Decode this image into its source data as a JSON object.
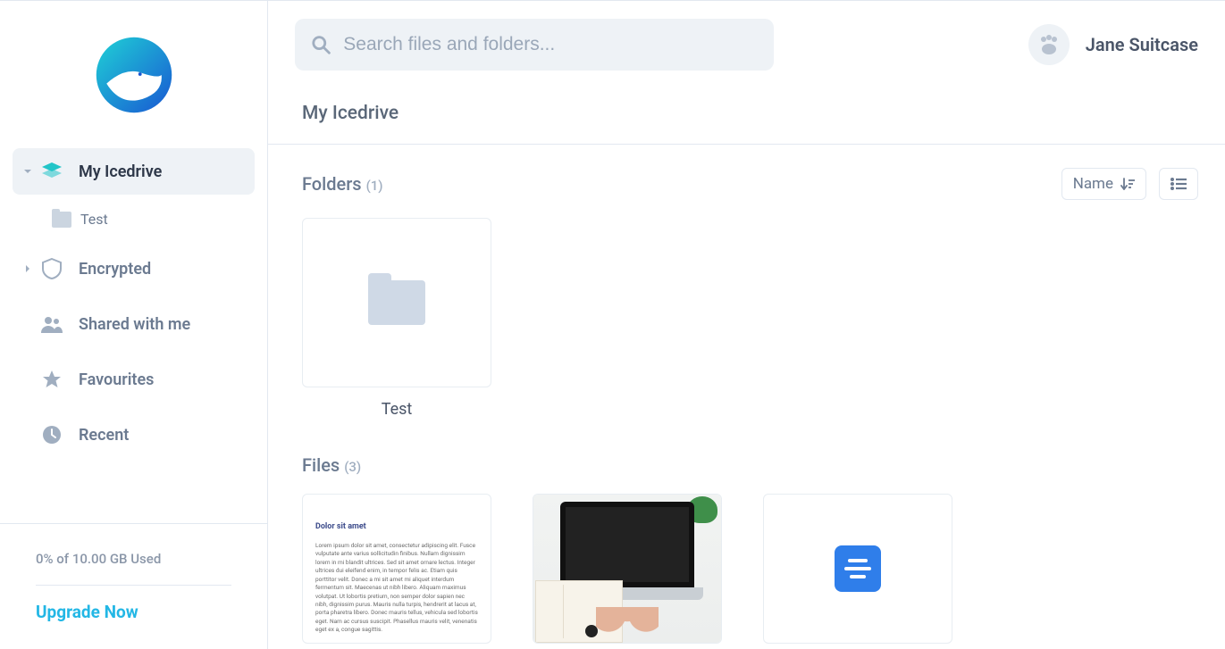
{
  "header": {
    "search_placeholder": "Search files and folders...",
    "user_name": "Jane Suitcase"
  },
  "breadcrumb": "My Icedrive",
  "sidebar": {
    "items": [
      {
        "label": "My Icedrive",
        "children": [
          {
            "label": "Test"
          }
        ]
      },
      {
        "label": "Encrypted"
      },
      {
        "label": "Shared with me"
      },
      {
        "label": "Favourites"
      },
      {
        "label": "Recent"
      }
    ],
    "storage_text": "0% of 10.00 GB Used",
    "upgrade_label": "Upgrade Now"
  },
  "sections": {
    "folders": {
      "title": "Folders",
      "count": "(1)",
      "items": [
        {
          "name": "Test"
        }
      ]
    },
    "files": {
      "title": "Files",
      "count": "(3)",
      "items": [
        {
          "type": "doc",
          "preview_title": "Dolor sit amet"
        },
        {
          "type": "image"
        },
        {
          "type": "generic"
        }
      ]
    }
  },
  "toolbar": {
    "sort_label": "Name"
  }
}
